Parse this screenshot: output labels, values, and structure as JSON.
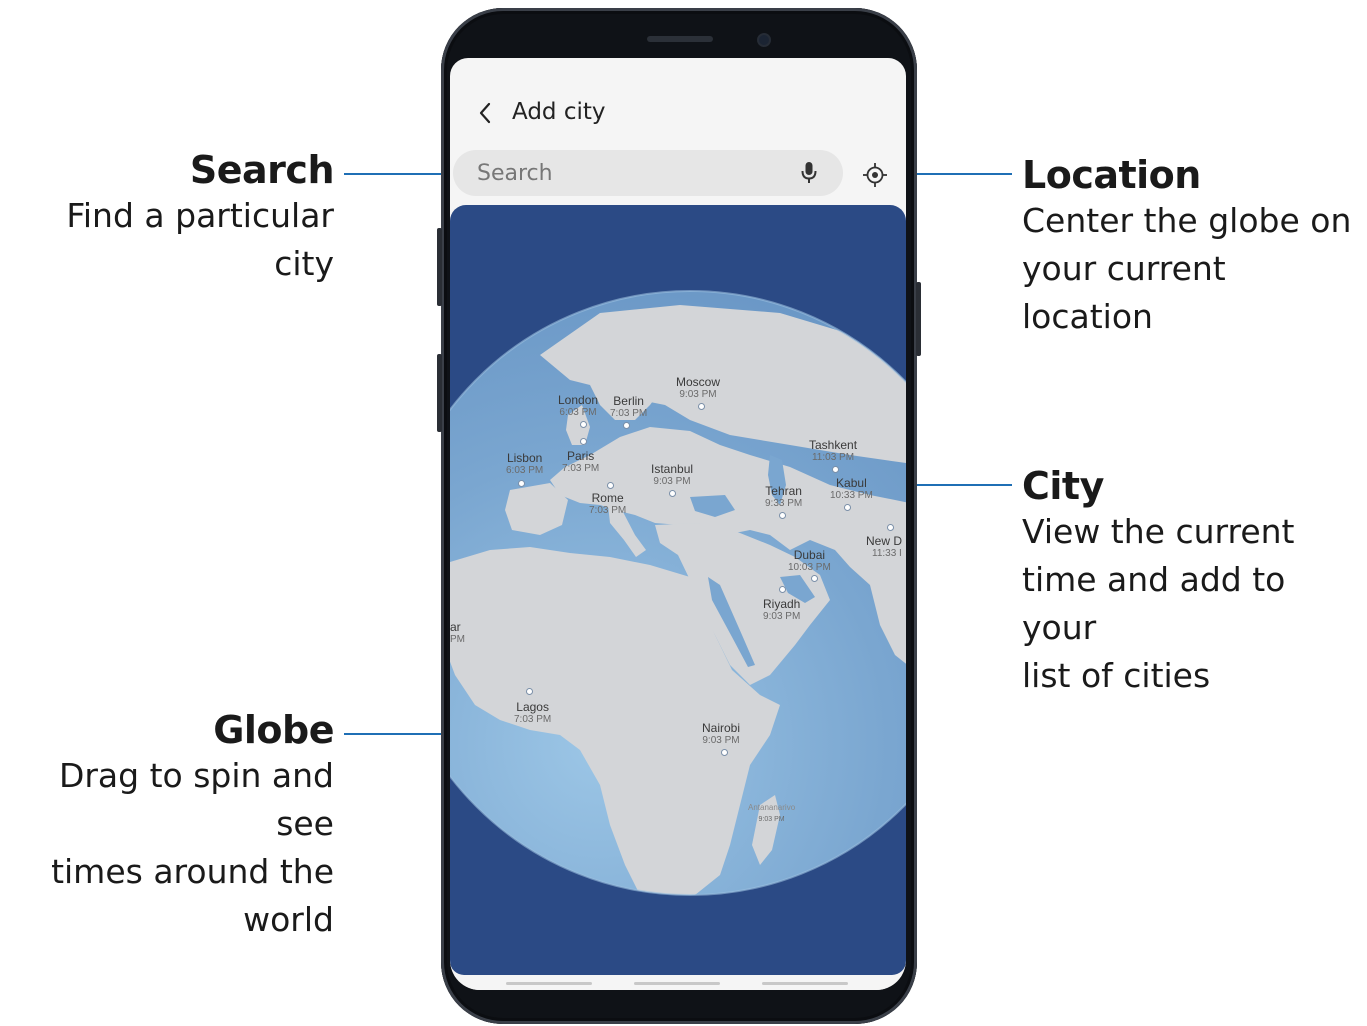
{
  "app": {
    "title": "Add city",
    "search_placeholder": "Search"
  },
  "icons": {
    "back": "back-arrow-icon",
    "mic": "microphone-icon",
    "location": "location-target-icon"
  },
  "callouts": {
    "search": {
      "title": "Search",
      "desc": "Find a particular city"
    },
    "location": {
      "title": "Location",
      "desc_line1": "Center the globe on",
      "desc_line2": "your current location"
    },
    "city": {
      "title": "City",
      "desc_line1": "View the current",
      "desc_line2": "time and add to your",
      "desc_line3": "list of cities"
    },
    "globe": {
      "title": "Globe",
      "desc_line1": "Drag to spin and see",
      "desc_line2": "times around the",
      "desc_line3": "world"
    }
  },
  "cities": {
    "moscow": {
      "name": "Moscow",
      "time": "9:03 PM"
    },
    "london": {
      "name": "London",
      "time": "6:03 PM"
    },
    "berlin": {
      "name": "Berlin",
      "time": "7:03 PM"
    },
    "lisbon": {
      "name": "Lisbon",
      "time": "6:03 PM"
    },
    "paris": {
      "name": "Paris",
      "time": "7:03 PM"
    },
    "istanbul": {
      "name": "Istanbul",
      "time": "9:03 PM"
    },
    "tashkent": {
      "name": "Tashkent",
      "time": "11:03 PM"
    },
    "kabul": {
      "name": "Kabul",
      "time": "10:33 PM"
    },
    "tehran": {
      "name": "Tehran",
      "time": "9:33 PM"
    },
    "rome": {
      "name": "Rome",
      "time": "7:03 PM"
    },
    "new_delhi": {
      "name": "New D",
      "time": "11:33 I"
    },
    "dubai": {
      "name": "Dubai",
      "time": "10:03 PM"
    },
    "riyadh": {
      "name": "Riyadh",
      "time": "9:03 PM"
    },
    "dakar": {
      "name": "ar",
      "time": "PM"
    },
    "lagos": {
      "name": "Lagos",
      "time": "7:03 PM"
    },
    "nairobi": {
      "name": "Nairobi",
      "time": "9:03 PM"
    },
    "antananarivo": {
      "name": "Antananarivo",
      "time": "9:03 PM"
    }
  },
  "colors": {
    "accent": "#1f6fb5",
    "globe_background": "#2b4a85",
    "ocean": "#7faad3",
    "land": "#d3d5d8"
  }
}
